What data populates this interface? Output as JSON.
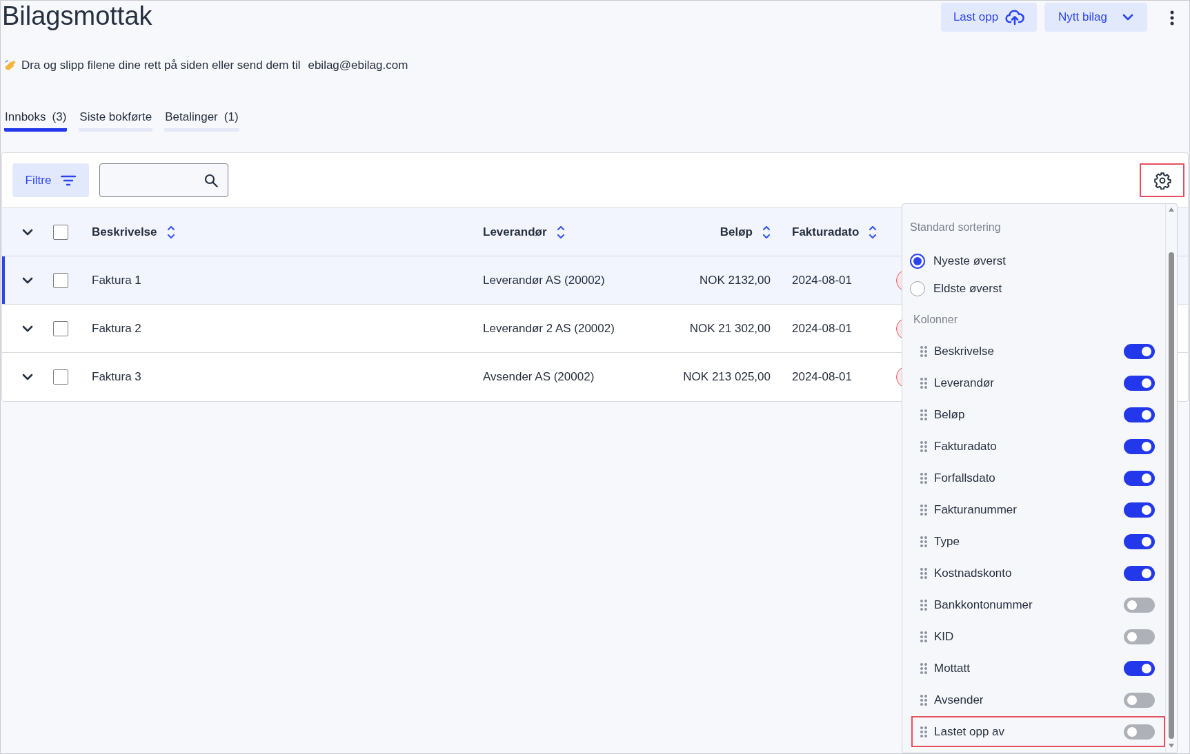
{
  "page": {
    "title": "Bilagsmottak",
    "info_text": "Dra og slipp filene dine rett på siden eller send dem til",
    "email": "ebilag@ebilag.com"
  },
  "header_buttons": [
    {
      "label": "Last opp",
      "kind": "upload"
    },
    {
      "label": "Nytt bilag",
      "kind": "dropdown"
    }
  ],
  "tabs": [
    {
      "label": "Innboks",
      "count": "(3)",
      "selected": true
    },
    {
      "label": "Siste bokførte",
      "selected": false
    },
    {
      "label": "Betalinger",
      "count": "(1)",
      "selected": false
    }
  ],
  "toolbar": {
    "filter_label": "Filtre",
    "settings_highlighted": true
  },
  "table": {
    "columns": [
      {
        "label": "Beskrivelse"
      },
      {
        "label": "Leverandør"
      },
      {
        "label": "Beløp"
      },
      {
        "label": "Fakturadato"
      }
    ],
    "all_checked": false,
    "rows": [
      {
        "cells": [
          "Faktura 1",
          "Leverandør AS (20002)",
          "NOK 2132,00",
          "2024-08-01"
        ],
        "selected": true,
        "checked": false
      },
      {
        "cells": [
          "Faktura 2",
          "Leverandør 2 AS (20002)",
          "NOK 21 302,00",
          "2024-08-01"
        ],
        "selected": false,
        "checked": false
      },
      {
        "cells": [
          "Faktura 3",
          "Avsender AS (20002)",
          "NOK 213 025,00",
          "2024-08-01"
        ],
        "selected": false,
        "checked": false
      }
    ]
  },
  "settings_menu": {
    "sort_title": "Standard sortering",
    "sort_options": [
      {
        "label": "Nyeste øverst",
        "selected": true
      },
      {
        "label": "Eldste øverst",
        "selected": false
      }
    ],
    "columns_title": "Kolonner",
    "columns": [
      {
        "label": "Beskrivelse",
        "on": true,
        "highlighted": false
      },
      {
        "label": "Leverandør",
        "on": true,
        "highlighted": false
      },
      {
        "label": "Beløp",
        "on": true,
        "highlighted": false
      },
      {
        "label": "Fakturadato",
        "on": true,
        "highlighted": false
      },
      {
        "label": "Forfallsdato",
        "on": true,
        "highlighted": false
      },
      {
        "label": "Fakturanummer",
        "on": true,
        "highlighted": false
      },
      {
        "label": "Type",
        "on": true,
        "highlighted": false
      },
      {
        "label": "Kostnadskonto",
        "on": true,
        "highlighted": false
      },
      {
        "label": "Bankkontonummer",
        "on": false,
        "highlighted": false
      },
      {
        "label": "KID",
        "on": false,
        "highlighted": false
      },
      {
        "label": "Mottatt",
        "on": true,
        "highlighted": false
      },
      {
        "label": "Avsender",
        "on": false,
        "highlighted": false
      },
      {
        "label": "Lastet opp av",
        "on": false,
        "highlighted": true
      }
    ]
  }
}
